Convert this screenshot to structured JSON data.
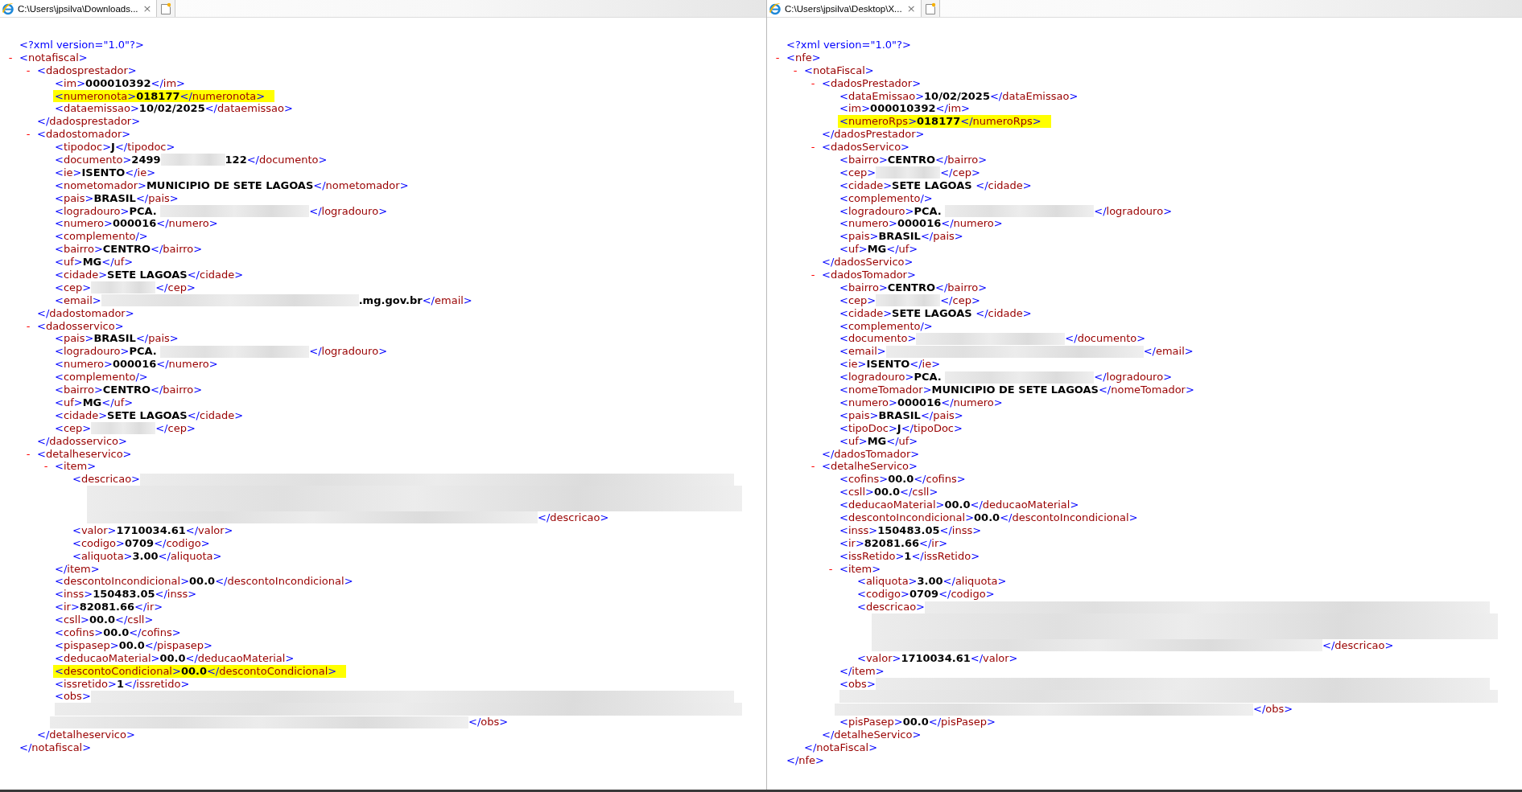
{
  "panes": [
    {
      "tab": {
        "title": "C:\\Users\\jpsilva\\Downloads...",
        "close": "×",
        "selected": true
      },
      "document": [
        {
          "kind": "decl",
          "text": "<?xml version=\"1.0\"?>"
        },
        {
          "kind": "node",
          "toggle": "-",
          "expanded": true,
          "open": "<notafiscal>",
          "close": "</notafiscal>",
          "children": [
            {
              "kind": "node",
              "toggle": "-",
              "expanded": true,
              "open": "<dadosprestador>",
              "close": "</dadosprestador>",
              "children": [
                {
                  "kind": "leaf",
                  "text": "<im>000010392</im>",
                  "highlighted": false
                },
                {
                  "kind": "leaf",
                  "text": "<numeronota>018177</numeronota>",
                  "highlighted": true
                },
                {
                  "kind": "leaf",
                  "text": "<dataemissao>10/02/2025</dataemissao>",
                  "highlighted": false
                }
              ]
            },
            {
              "kind": "node",
              "toggle": "-",
              "expanded": true,
              "open": "<dadostomador>",
              "close": "</dadostomador>",
              "children": [
                {
                  "kind": "leaf",
                  "text": "<tipodoc>J</tipodoc>",
                  "highlighted": false
                },
                {
                  "kind": "redactshort",
                  "parts": [
                    "<documento>2499",
                    "122</documento>"
                  ]
                },
                {
                  "kind": "leaf",
                  "text": "<ie>ISENTO</ie>",
                  "highlighted": false
                },
                {
                  "kind": "leaf",
                  "text": "<nometomador>MUNICIPIO DE SETE LAGOAS</nometomador>",
                  "highlighted": false
                },
                {
                  "kind": "leaf",
                  "text": "<pais>BRASIL</pais>",
                  "highlighted": false
                },
                {
                  "kind": "redactmedium",
                  "parts": [
                    "<logradouro>PCA. ",
                    "</logradouro>"
                  ]
                },
                {
                  "kind": "leaf",
                  "text": "<numero>000016</numero>",
                  "highlighted": false
                },
                {
                  "kind": "leaf",
                  "text": "<complemento/>",
                  "highlighted": false
                },
                {
                  "kind": "leaf",
                  "text": "<bairro>CENTRO</bairro>",
                  "highlighted": false
                },
                {
                  "kind": "leaf",
                  "text": "<uf>MG</uf>",
                  "highlighted": false
                },
                {
                  "kind": "leaf",
                  "text": "<cidade>SETE LAGOAS</cidade>",
                  "highlighted": false
                },
                {
                  "kind": "redactshort",
                  "parts": [
                    "<cep>",
                    "</cep>"
                  ]
                },
                {
                  "kind": "redactlong",
                  "parts": [
                    "<email>",
                    ".mg.gov.br</email>"
                  ]
                }
              ]
            },
            {
              "kind": "node",
              "toggle": "-",
              "expanded": true,
              "open": "<dadosservico>",
              "close": "</dadosservico>",
              "children": [
                {
                  "kind": "leaf",
                  "text": "<pais>BRASIL</pais>",
                  "highlighted": false
                },
                {
                  "kind": "redactmedium",
                  "parts": [
                    "<logradouro>PCA. ",
                    "</logradouro>"
                  ]
                },
                {
                  "kind": "leaf",
                  "text": "<numero>000016</numero>",
                  "highlighted": false
                },
                {
                  "kind": "leaf",
                  "text": "<complemento/>",
                  "highlighted": false
                },
                {
                  "kind": "leaf",
                  "text": "<bairro>CENTRO</bairro>",
                  "highlighted": false
                },
                {
                  "kind": "leaf",
                  "text": "<uf>MG</uf>",
                  "highlighted": false
                },
                {
                  "kind": "leaf",
                  "text": "<cidade>SETE LAGOAS</cidade>",
                  "highlighted": false
                },
                {
                  "kind": "redactshort",
                  "parts": [
                    "<cep>",
                    "</cep>"
                  ]
                }
              ]
            },
            {
              "kind": "node",
              "toggle": "-",
              "expanded": true,
              "open": "<detalheservico>",
              "close": "</detalheservico>",
              "children": [
                {
                  "kind": "node",
                  "toggle": "-",
                  "expanded": true,
                  "open": "<item>",
                  "close": "</item>",
                  "children": [
                    {
                      "kind": "blocktall",
                      "parts": [
                        "<descricao>",
                        "</descricao>"
                      ]
                    },
                    {
                      "kind": "leaf",
                      "text": "<valor>1710034.61</valor>",
                      "highlighted": false
                    },
                    {
                      "kind": "leaf",
                      "text": "<codigo>0709</codigo>",
                      "highlighted": false
                    },
                    {
                      "kind": "leaf",
                      "text": "<aliquota>3.00</aliquota>",
                      "highlighted": false
                    }
                  ]
                },
                {
                  "kind": "leaf",
                  "text": "<descontoIncondicional>00.0</descontoIncondicional>",
                  "highlighted": false
                },
                {
                  "kind": "leaf",
                  "text": "<inss>150483.05</inss>",
                  "highlighted": false
                },
                {
                  "kind": "leaf",
                  "text": "<ir>82081.66</ir>",
                  "highlighted": false
                },
                {
                  "kind": "leaf",
                  "text": "<csll>00.0</csll>",
                  "highlighted": false
                },
                {
                  "kind": "leaf",
                  "text": "<cofins>00.0</cofins>",
                  "highlighted": false
                },
                {
                  "kind": "leaf",
                  "text": "<pispasep>00.0</pispasep>",
                  "highlighted": false
                },
                {
                  "kind": "leaf",
                  "text": "<deducaoMaterial>00.0</deducaoMaterial>",
                  "highlighted": false
                },
                {
                  "kind": "leaf",
                  "text": "<descontoCondicional>00.0</descontoCondicional>",
                  "highlighted": true
                },
                {
                  "kind": "leaf",
                  "text": "<issretido>1</issretido>",
                  "highlighted": false
                },
                {
                  "kind": "blockshort",
                  "parts": [
                    "<obs>",
                    "</obs>"
                  ]
                }
              ]
            }
          ]
        }
      ]
    },
    {
      "tab": {
        "title": "C:\\Users\\jpsilva\\Desktop\\X...",
        "close": "×",
        "selected": true
      },
      "document": [
        {
          "kind": "decl",
          "text": "<?xml version=\"1.0\"?>"
        },
        {
          "kind": "node",
          "toggle": "-",
          "expanded": true,
          "open": "<nfe>",
          "close": "</nfe>",
          "children": [
            {
              "kind": "node",
              "toggle": "-",
              "expanded": true,
              "open": "<notaFiscal>",
              "close": "</notaFiscal>",
              "children": [
                {
                  "kind": "node",
                  "toggle": "-",
                  "expanded": true,
                  "open": "<dadosPrestador>",
                  "close": "</dadosPrestador>",
                  "children": [
                    {
                      "kind": "leaf",
                      "text": "<dataEmissao>10/02/2025</dataEmissao>",
                      "highlighted": false
                    },
                    {
                      "kind": "leaf",
                      "text": "<im>000010392</im>",
                      "highlighted": false
                    },
                    {
                      "kind": "leaf",
                      "text": "<numeroRps>018177</numeroRps>",
                      "highlighted": true
                    }
                  ]
                },
                {
                  "kind": "node",
                  "toggle": "-",
                  "expanded": true,
                  "open": "<dadosServico>",
                  "close": "</dadosServico>",
                  "children": [
                    {
                      "kind": "leaf",
                      "text": "<bairro>CENTRO</bairro>",
                      "highlighted": false
                    },
                    {
                      "kind": "redactshort",
                      "parts": [
                        "<cep>",
                        "</cep>"
                      ]
                    },
                    {
                      "kind": "leaf",
                      "text": "<cidade>SETE LAGOAS </cidade>",
                      "highlighted": false
                    },
                    {
                      "kind": "leaf",
                      "text": "<complemento/>",
                      "highlighted": false
                    },
                    {
                      "kind": "redactmedium",
                      "parts": [
                        "<logradouro>PCA. ",
                        "</logradouro>"
                      ]
                    },
                    {
                      "kind": "leaf",
                      "text": "<numero>000016</numero>",
                      "highlighted": false
                    },
                    {
                      "kind": "leaf",
                      "text": "<pais>BRASIL</pais>",
                      "highlighted": false
                    },
                    {
                      "kind": "leaf",
                      "text": "<uf>MG</uf>",
                      "highlighted": false
                    }
                  ]
                },
                {
                  "kind": "node",
                  "toggle": "-",
                  "expanded": true,
                  "open": "<dadosTomador>",
                  "close": "</dadosTomador>",
                  "children": [
                    {
                      "kind": "leaf",
                      "text": "<bairro>CENTRO</bairro>",
                      "highlighted": false
                    },
                    {
                      "kind": "redactshort",
                      "parts": [
                        "<cep>",
                        "</cep>"
                      ]
                    },
                    {
                      "kind": "leaf",
                      "text": "<cidade>SETE LAGOAS </cidade>",
                      "highlighted": false
                    },
                    {
                      "kind": "leaf",
                      "text": "<complemento/>",
                      "highlighted": false
                    },
                    {
                      "kind": "redactmedium",
                      "parts": [
                        "<documento>",
                        "</documento>"
                      ]
                    },
                    {
                      "kind": "redactlong",
                      "parts": [
                        "<email>",
                        "</email>"
                      ]
                    },
                    {
                      "kind": "leaf",
                      "text": "<ie>ISENTO</ie>",
                      "highlighted": false
                    },
                    {
                      "kind": "redactmedium",
                      "parts": [
                        "<logradouro>PCA. ",
                        "</logradouro>"
                      ]
                    },
                    {
                      "kind": "leaf",
                      "text": "<nomeTomador>MUNICIPIO DE SETE LAGOAS</nomeTomador>",
                      "highlighted": false
                    },
                    {
                      "kind": "leaf",
                      "text": "<numero>000016</numero>",
                      "highlighted": false
                    },
                    {
                      "kind": "leaf",
                      "text": "<pais>BRASIL</pais>",
                      "highlighted": false
                    },
                    {
                      "kind": "leaf",
                      "text": "<tipoDoc>J</tipoDoc>",
                      "highlighted": false
                    },
                    {
                      "kind": "leaf",
                      "text": "<uf>MG</uf>",
                      "highlighted": false
                    }
                  ]
                },
                {
                  "kind": "node",
                  "toggle": "-",
                  "expanded": true,
                  "open": "<detalheServico>",
                  "close": "</detalheServico>",
                  "children": [
                    {
                      "kind": "leaf",
                      "text": "<cofins>00.0</cofins>",
                      "highlighted": false
                    },
                    {
                      "kind": "leaf",
                      "text": "<csll>00.0</csll>",
                      "highlighted": false
                    },
                    {
                      "kind": "leaf",
                      "text": "<deducaoMaterial>00.0</deducaoMaterial>",
                      "highlighted": false
                    },
                    {
                      "kind": "leaf",
                      "text": "<descontoIncondicional>00.0</descontoIncondicional>",
                      "highlighted": false
                    },
                    {
                      "kind": "leaf",
                      "text": "<inss>150483.05</inss>",
                      "highlighted": false
                    },
                    {
                      "kind": "leaf",
                      "text": "<ir>82081.66</ir>",
                      "highlighted": false
                    },
                    {
                      "kind": "leaf",
                      "text": "<issRetido>1</issRetido>",
                      "highlighted": false
                    },
                    {
                      "kind": "node",
                      "toggle": "-",
                      "expanded": true,
                      "open": "<item>",
                      "close": "</item>",
                      "children": [
                        {
                          "kind": "leaf",
                          "text": "<aliquota>3.00</aliquota>",
                          "highlighted": false
                        },
                        {
                          "kind": "leaf",
                          "text": "<codigo>0709</codigo>",
                          "highlighted": false
                        },
                        {
                          "kind": "blocktall",
                          "parts": [
                            "<descricao>",
                            "</descricao>"
                          ]
                        },
                        {
                          "kind": "leaf",
                          "text": "<valor>1710034.61</valor>",
                          "highlighted": false
                        }
                      ]
                    },
                    {
                      "kind": "blockshort",
                      "parts": [
                        "<obs>",
                        "</obs>"
                      ]
                    },
                    {
                      "kind": "leaf",
                      "text": "<pisPasep>00.0</pisPasep>",
                      "highlighted": false
                    }
                  ]
                }
              ]
            }
          ]
        }
      ]
    }
  ]
}
